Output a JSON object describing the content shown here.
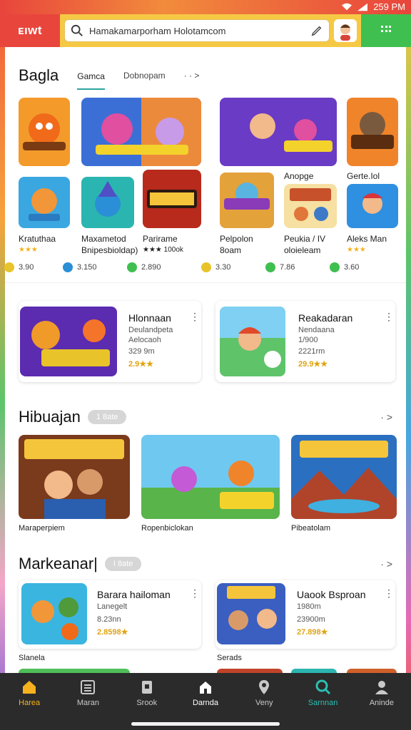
{
  "status_bar": {
    "time": "259 PM"
  },
  "brand": {
    "logo_text": "ᴇıwt"
  },
  "search": {
    "placeholder": "Hamakamarporham Holotamcom"
  },
  "section1": {
    "title": "Bagla",
    "tabs": [
      {
        "label": "Gamca",
        "active": true
      },
      {
        "label": "Dobnopam",
        "active": false
      }
    ],
    "more": "· · >"
  },
  "apps_row1": [
    {
      "label": "",
      "sub": ""
    },
    {
      "label": "",
      "sub": ""
    },
    {
      "label": "",
      "sub": ""
    },
    {
      "label": "",
      "sub": ""
    }
  ],
  "apps_row2": [
    {
      "title": "Kratuthaa",
      "line2": "★★★",
      "price": "3.90"
    },
    {
      "title": "Maxametod",
      "line2": "Bnipesbioldap)",
      "price": "3.150"
    },
    {
      "title": "Parirame",
      "line2": "★★★ 100ok",
      "price": "2.890"
    },
    {
      "title": "Pelpolon",
      "line2": "8oam",
      "price": "3.30"
    },
    {
      "title": "Peukia / IV",
      "line2": "oloieleam",
      "price": "7.86"
    },
    {
      "title": "Aleks Man",
      "line2": "★★★",
      "price": "3.60"
    }
  ],
  "row1_extra_labels": [
    "Anopge",
    "Gerte.Iol"
  ],
  "featured_cards": [
    {
      "title": "Hlonnaan",
      "sub1": "Deulandpeta",
      "sub2": "Aelocaoh",
      "sub3": "329 9m",
      "rating": "2.9★★"
    },
    {
      "title": "Reakadaran",
      "sub1": "Nendaana",
      "sub2": "1/900",
      "sub3": "2221rm",
      "rating": "29.9★★"
    }
  ],
  "section2": {
    "title": "Hibuajan",
    "pill": "1 8ate",
    "more": "· >",
    "items": [
      {
        "label": "Maraperpiem"
      },
      {
        "label": "Ropenbiclokan"
      },
      {
        "label": "Pibeatolam"
      }
    ]
  },
  "section3": {
    "title": "Markeanar|",
    "pill": "I 8ate",
    "more": "· >",
    "cards": [
      {
        "title": "Barara hailoman",
        "sub1": "Lanegelt",
        "sub2": "8.23nn",
        "rating": "2.8598★",
        "caption": "Slanela"
      },
      {
        "title": "Uaook Bsproan",
        "sub1": "1980m",
        "sub2": "23900m",
        "rating": "27.898★",
        "caption": "Serads"
      }
    ]
  },
  "bottom_nav": [
    {
      "label": "Harea",
      "icon": "home-icon",
      "state": "active"
    },
    {
      "label": "Maran",
      "icon": "list-icon",
      "state": ""
    },
    {
      "label": "Srook",
      "icon": "bookmark-icon",
      "state": ""
    },
    {
      "label": "Darnda",
      "icon": "house-icon",
      "state": ""
    },
    {
      "label": "Veny",
      "icon": "location-icon",
      "state": ""
    },
    {
      "label": "Sarnnan",
      "icon": "search-icon",
      "state": "active2"
    },
    {
      "label": "Aninde",
      "icon": "person-icon",
      "state": ""
    }
  ],
  "colors": {
    "brand": "#e8453c",
    "search_bg": "#f6c945",
    "grid_bg": "#3fbf4f",
    "accent_tab": "#2aa5a0",
    "star": "#f5b21c"
  }
}
